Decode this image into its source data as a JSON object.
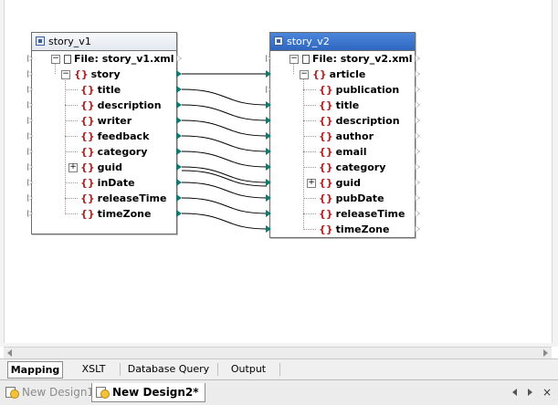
{
  "source_component": {
    "title": "story_v1",
    "file_label": "File: story_v1.xml",
    "root_element": "story",
    "children": [
      "title",
      "description",
      "writer",
      "feedback",
      "category",
      "guid",
      "inDate",
      "releaseTime",
      "timeZone"
    ]
  },
  "target_component": {
    "title": "story_v2",
    "file_label": "File: story_v2.xml",
    "root_element": "article",
    "children": [
      "publication",
      "title",
      "description",
      "author",
      "email",
      "category",
      "guid",
      "pubDate",
      "releaseTime",
      "timeZone"
    ]
  },
  "element_icon": "{}",
  "expander_plus": "+",
  "expander_minus": "−",
  "view_tabs": [
    "Mapping",
    "XSLT",
    "Database Query",
    "Output"
  ],
  "active_view_tab": "Mapping",
  "document_tabs": [
    {
      "label": "New Design1",
      "active": false
    },
    {
      "label": "New Design2*",
      "active": true
    }
  ],
  "colors": {
    "connector": "#000000",
    "port_connected": "#0f7b6f",
    "target_titlebar": "#3a74cf"
  },
  "icons": [
    "component-icon",
    "file-icon",
    "expand-icon",
    "collapse-icon",
    "scroll-left-icon",
    "scroll-right-icon",
    "tab-prev-icon",
    "tab-next-icon",
    "close-tab-icon",
    "design-file-icon"
  ]
}
